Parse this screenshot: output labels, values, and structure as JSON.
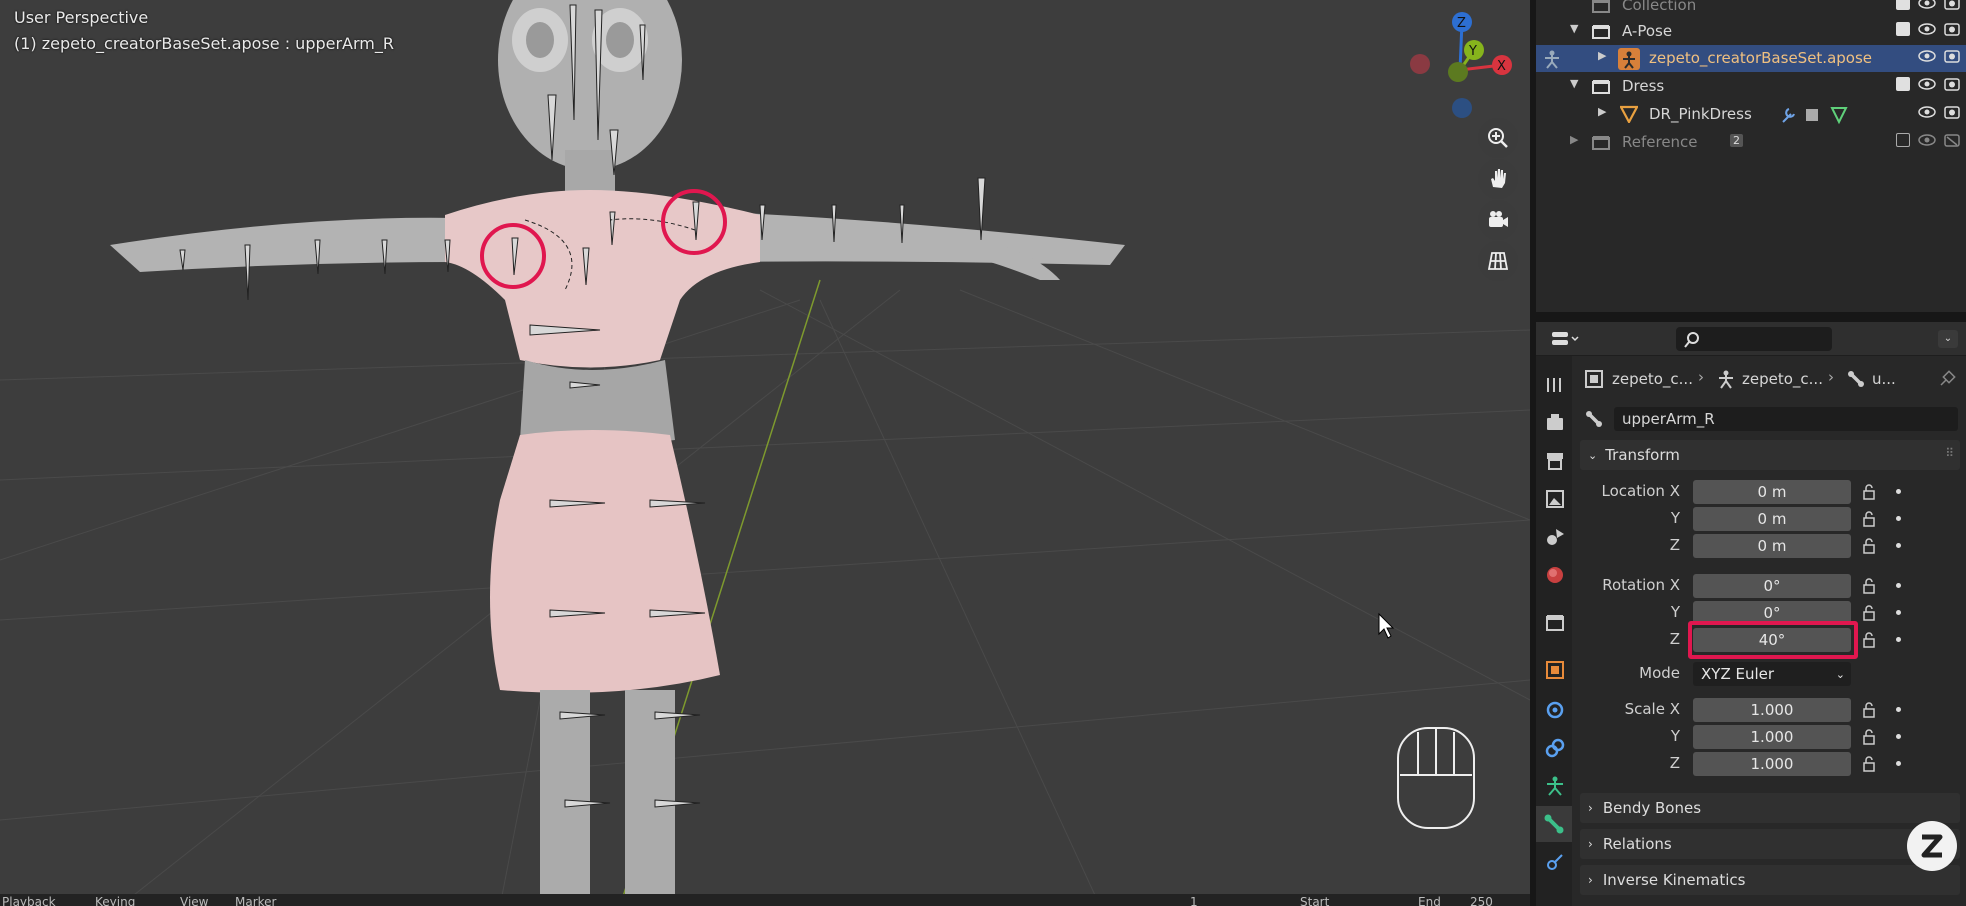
{
  "viewport": {
    "view_name": "User Perspective",
    "object_info": "(1) zepeto_creatorBaseSet.apose : upperArm_R",
    "gizmo": {
      "x_label": "X",
      "y_label": "Y",
      "z_label": "Z"
    },
    "nav_tools": [
      "zoom-icon",
      "hand-pan-icon",
      "camera-icon",
      "grid-ortho-icon"
    ],
    "colors": {
      "highlight": "#e0174f",
      "dress": "#e9c4c4",
      "body": "#b4b4b4"
    }
  },
  "outliner": {
    "rows": [
      {
        "label": "Collection",
        "icon": "collection-icon",
        "dim": true
      },
      {
        "label": "A-Pose",
        "icon": "collection-icon"
      },
      {
        "label": "zepeto_creatorBaseSet.apose",
        "icon": "armature-icon",
        "selected": true
      },
      {
        "label": "Dress",
        "icon": "collection-icon"
      },
      {
        "label": "DR_PinkDress",
        "icon": "mesh-icon"
      },
      {
        "label": "Reference",
        "icon": "collection-icon",
        "dim": true,
        "badge": "2"
      }
    ]
  },
  "properties": {
    "breadcrumb": [
      "zepeto_c...",
      "zepeto_c...",
      "u..."
    ],
    "bone_name": "upperArm_R",
    "transform": {
      "title": "Transform",
      "location": {
        "label_x": "Location X",
        "label_y": "Y",
        "label_z": "Z",
        "x": "0 m",
        "y": "0 m",
        "z": "0 m"
      },
      "rotation": {
        "label_x": "Rotation X",
        "label_y": "Y",
        "label_z": "Z",
        "x": "0°",
        "y": "0°",
        "z": "40°"
      },
      "mode": {
        "label": "Mode",
        "value": "XYZ Euler"
      },
      "scale": {
        "label_x": "Scale X",
        "label_y": "Y",
        "label_z": "Z",
        "x": "1.000",
        "y": "1.000",
        "z": "1.000"
      }
    },
    "panels": [
      "Bendy Bones",
      "Relations",
      "Inverse Kinematics"
    ]
  },
  "timeline": {
    "items": [
      "Playback",
      "Keying",
      "View",
      "Marker"
    ],
    "start_label": "Start",
    "end_label": "End",
    "end_value": "250",
    "frame": "1"
  }
}
